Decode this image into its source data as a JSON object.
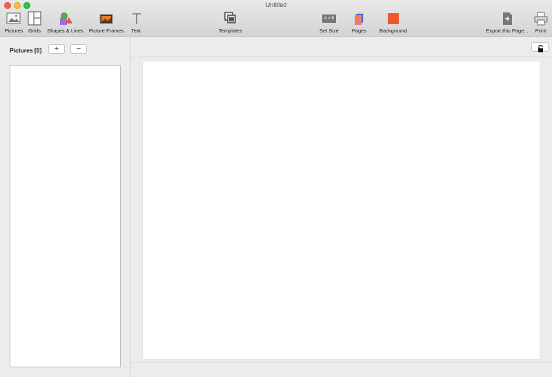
{
  "window": {
    "title": "Untitled"
  },
  "toolbar": {
    "pictures": "Pictures",
    "grids": "Grids",
    "shapes": "Shapes & Lines",
    "frames": "Picture Frames",
    "text": "Text",
    "templates": "Templates",
    "set_size": "Set Size",
    "set_size_icon_text": "A × B",
    "pages": "Pages",
    "background": "Background",
    "export": "Export this Page...",
    "print": "Print"
  },
  "sidebar": {
    "pictures_label": "Pictures [0]",
    "add": "+",
    "remove": "−"
  },
  "colors": {
    "background_swatch": "#ee5a2b",
    "shape_green": "#5aa84a",
    "shape_red": "#e8503a",
    "shape_purple": "#9b6ee0"
  },
  "icons": {
    "pictures": "image-icon",
    "grids": "grid-layout-icon",
    "shapes": "shapes-icon",
    "frames": "picture-frame-icon",
    "text": "text-T-icon",
    "templates": "templates-icon",
    "set_size": "set-size-icon",
    "pages": "pages-icon",
    "background": "background-swatch-icon",
    "export": "export-page-icon",
    "print": "printer-icon",
    "lock": "unlocked-padlock-icon"
  }
}
